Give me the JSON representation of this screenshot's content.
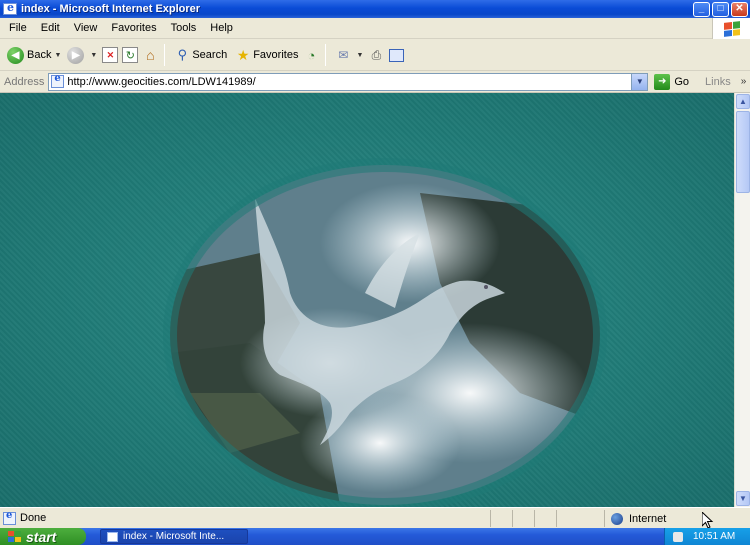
{
  "window": {
    "title": "index - Microsoft Internet Explorer",
    "minimize_glyph": "_",
    "maximize_glyph": "□",
    "close_glyph": "✕"
  },
  "menu": {
    "items": [
      "File",
      "Edit",
      "View",
      "Favorites",
      "Tools",
      "Help"
    ]
  },
  "toolbar": {
    "back_label": "Back",
    "search_label": "Search",
    "favorites_label": "Favorites"
  },
  "address": {
    "label": "Address",
    "url": "http://www.geocities.com/LDW141989/",
    "go_label": "Go",
    "links_label": "Links",
    "more_glyph": "»"
  },
  "content": {
    "background_color": "#1f7a76",
    "image_subject": "dove over waterfall"
  },
  "status": {
    "text": "Done",
    "zone": "Internet"
  },
  "taskbar": {
    "start_label": "start",
    "task_label": "index - Microsoft Inte...",
    "clock": "10:51 AM"
  },
  "colors": {
    "titlebar": "#0a4bd6",
    "page_background": "#1f7a76",
    "taskbar": "#245ad8",
    "start_button": "#2f8f24"
  }
}
